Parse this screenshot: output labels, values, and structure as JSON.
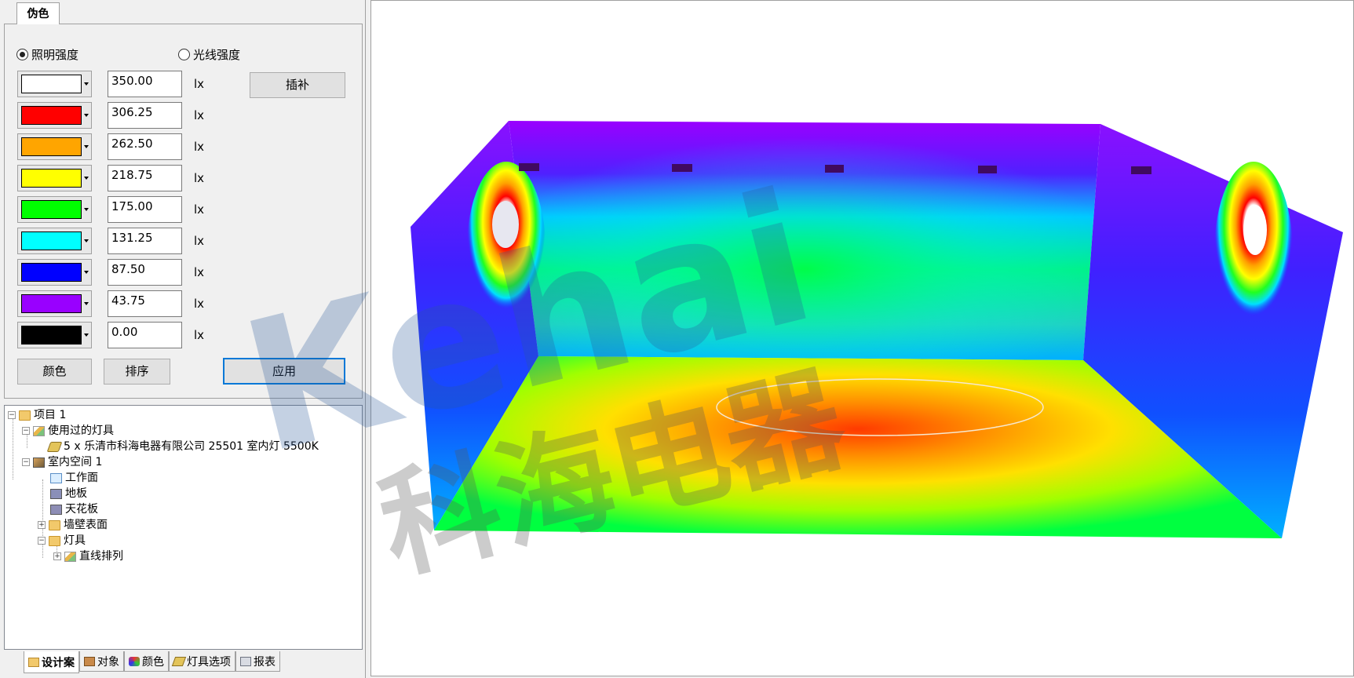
{
  "left_panel": {
    "top_tab": "伪色",
    "radio_illuminance": "照明强度",
    "radio_luminance": "光线强度",
    "interpolate_button": "插补",
    "levels": [
      {
        "value": "350.00",
        "unit": "lx",
        "color": "#ffffff"
      },
      {
        "value": "306.25",
        "unit": "lx",
        "color": "#ff0000"
      },
      {
        "value": "262.50",
        "unit": "lx",
        "color": "#ffa500"
      },
      {
        "value": "218.75",
        "unit": "lx",
        "color": "#ffff00"
      },
      {
        "value": "175.00",
        "unit": "lx",
        "color": "#00ff00"
      },
      {
        "value": "131.25",
        "unit": "lx",
        "color": "#00ffff"
      },
      {
        "value": "87.50",
        "unit": "lx",
        "color": "#0000ff"
      },
      {
        "value": "43.75",
        "unit": "lx",
        "color": "#9900ff"
      },
      {
        "value": "0.00",
        "unit": "lx",
        "color": "#000000"
      }
    ],
    "color_button": "颜色",
    "sort_button": "排序",
    "apply_button": "应用"
  },
  "tree": {
    "project": "项目 1",
    "used_luminaires": "使用过的灯具",
    "luminaire_item": "5 x 乐清市科海电器有限公司 25501 室内灯 5500K",
    "room": "室内空间 1",
    "workplane": "工作面",
    "floor": "地板",
    "ceiling": "天花板",
    "walls": "墙壁表面",
    "luminaires": "灯具",
    "line_arrangement": "直线排列"
  },
  "bottom_tabs": [
    {
      "label": "设计案",
      "icon": "design-icon"
    },
    {
      "label": "对象",
      "icon": "object-icon"
    },
    {
      "label": "颜色",
      "icon": "color-icon"
    },
    {
      "label": "灯具选项",
      "icon": "luminaire-icon"
    },
    {
      "label": "报表",
      "icon": "report-icon"
    }
  ],
  "watermark": {
    "letters": "Kehai",
    "chinese": "科海电器"
  }
}
